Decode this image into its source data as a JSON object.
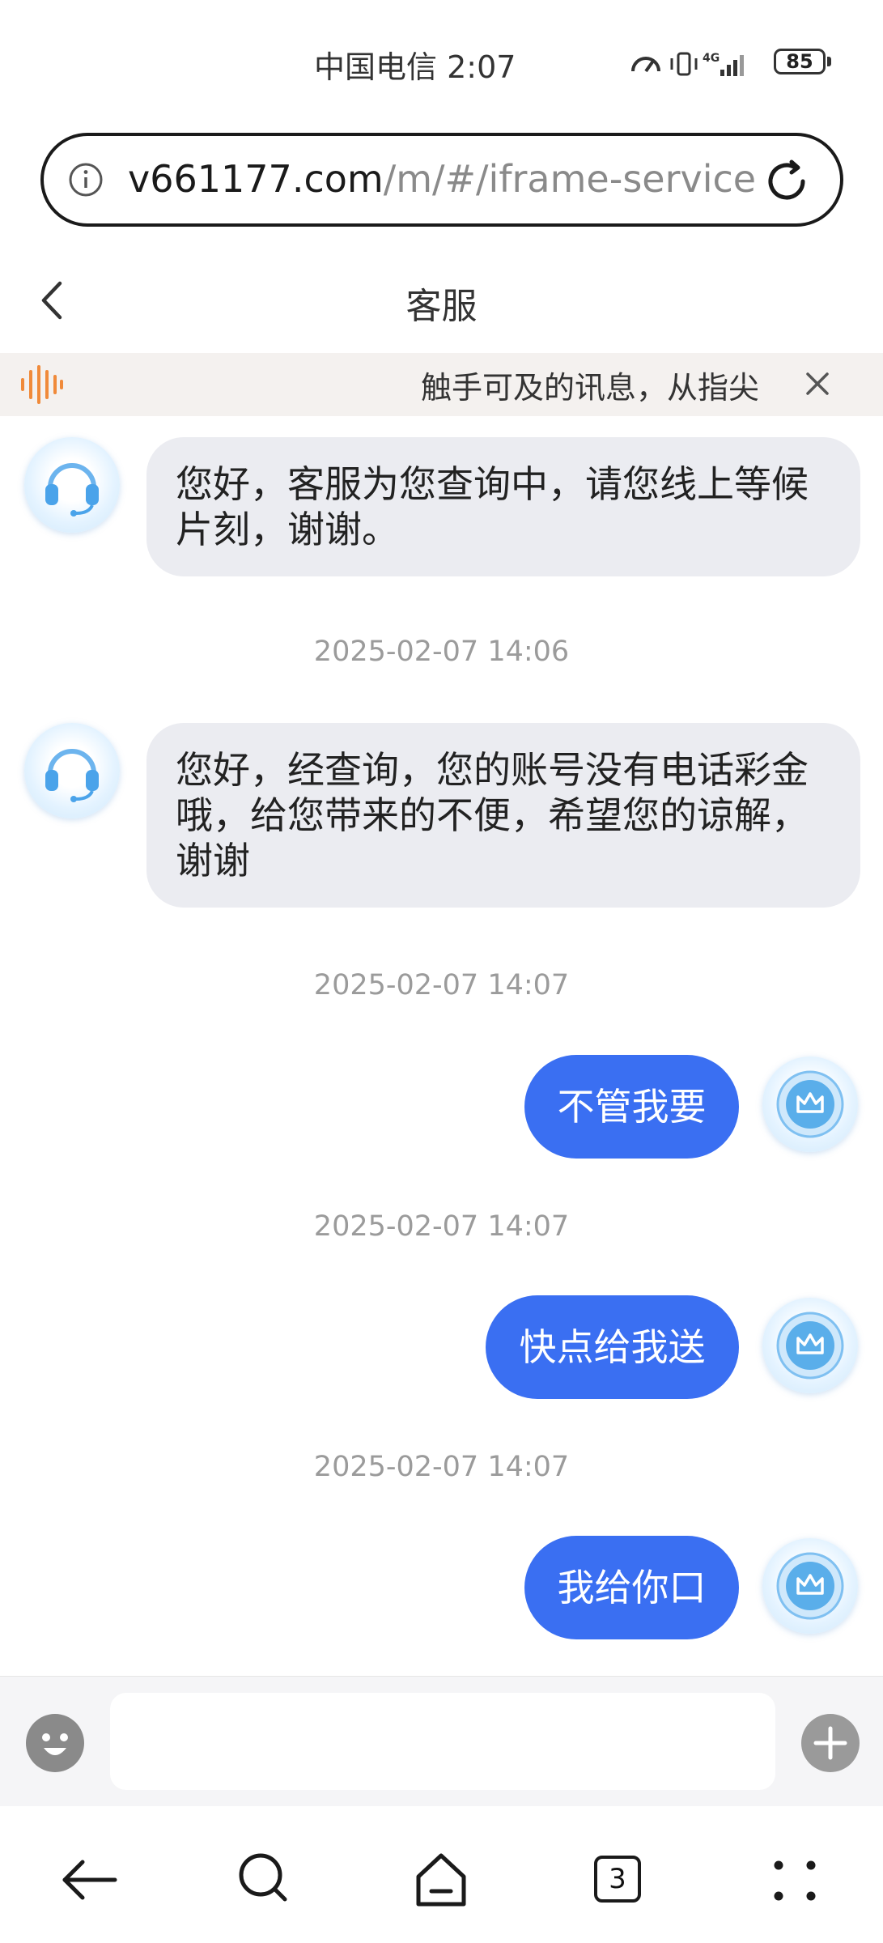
{
  "status_bar": {
    "carrier": "中国电信",
    "time": "2:07",
    "network": "4G",
    "battery": "85"
  },
  "url_bar": {
    "host": "v661177.com",
    "path": "/m/#/iframe-service"
  },
  "header": {
    "title": "客服"
  },
  "notice": {
    "text": "触手可及的讯息，从指尖"
  },
  "messages": [
    {
      "from": "agent",
      "text": "您好，客服为您查询中，请您线上等候片刻，谢谢。"
    },
    {
      "time": "2025-02-07 14:06"
    },
    {
      "from": "agent",
      "text": "您好，经查询，您的账号没有电话彩金哦，给您带来的不便，希望您的谅解，谢谢"
    },
    {
      "time": "2025-02-07 14:07"
    },
    {
      "from": "user",
      "text": "不管我要"
    },
    {
      "time": "2025-02-07 14:07"
    },
    {
      "from": "user",
      "text": "快点给我送"
    },
    {
      "time": "2025-02-07 14:07"
    },
    {
      "from": "user",
      "text": "我给你口"
    }
  ],
  "input": {
    "placeholder": ""
  },
  "bottom_nav": {
    "tab_count": "3",
    "icons": [
      "back-arrow-icon",
      "search-icon",
      "home-icon",
      "tabs-icon",
      "more-icon"
    ]
  },
  "colors": {
    "user_bubble": "#3a6ff2",
    "agent_bubble": "#ebecf1",
    "notice_bg": "#f4f1ef",
    "notice_icon": "#f08a3a"
  }
}
